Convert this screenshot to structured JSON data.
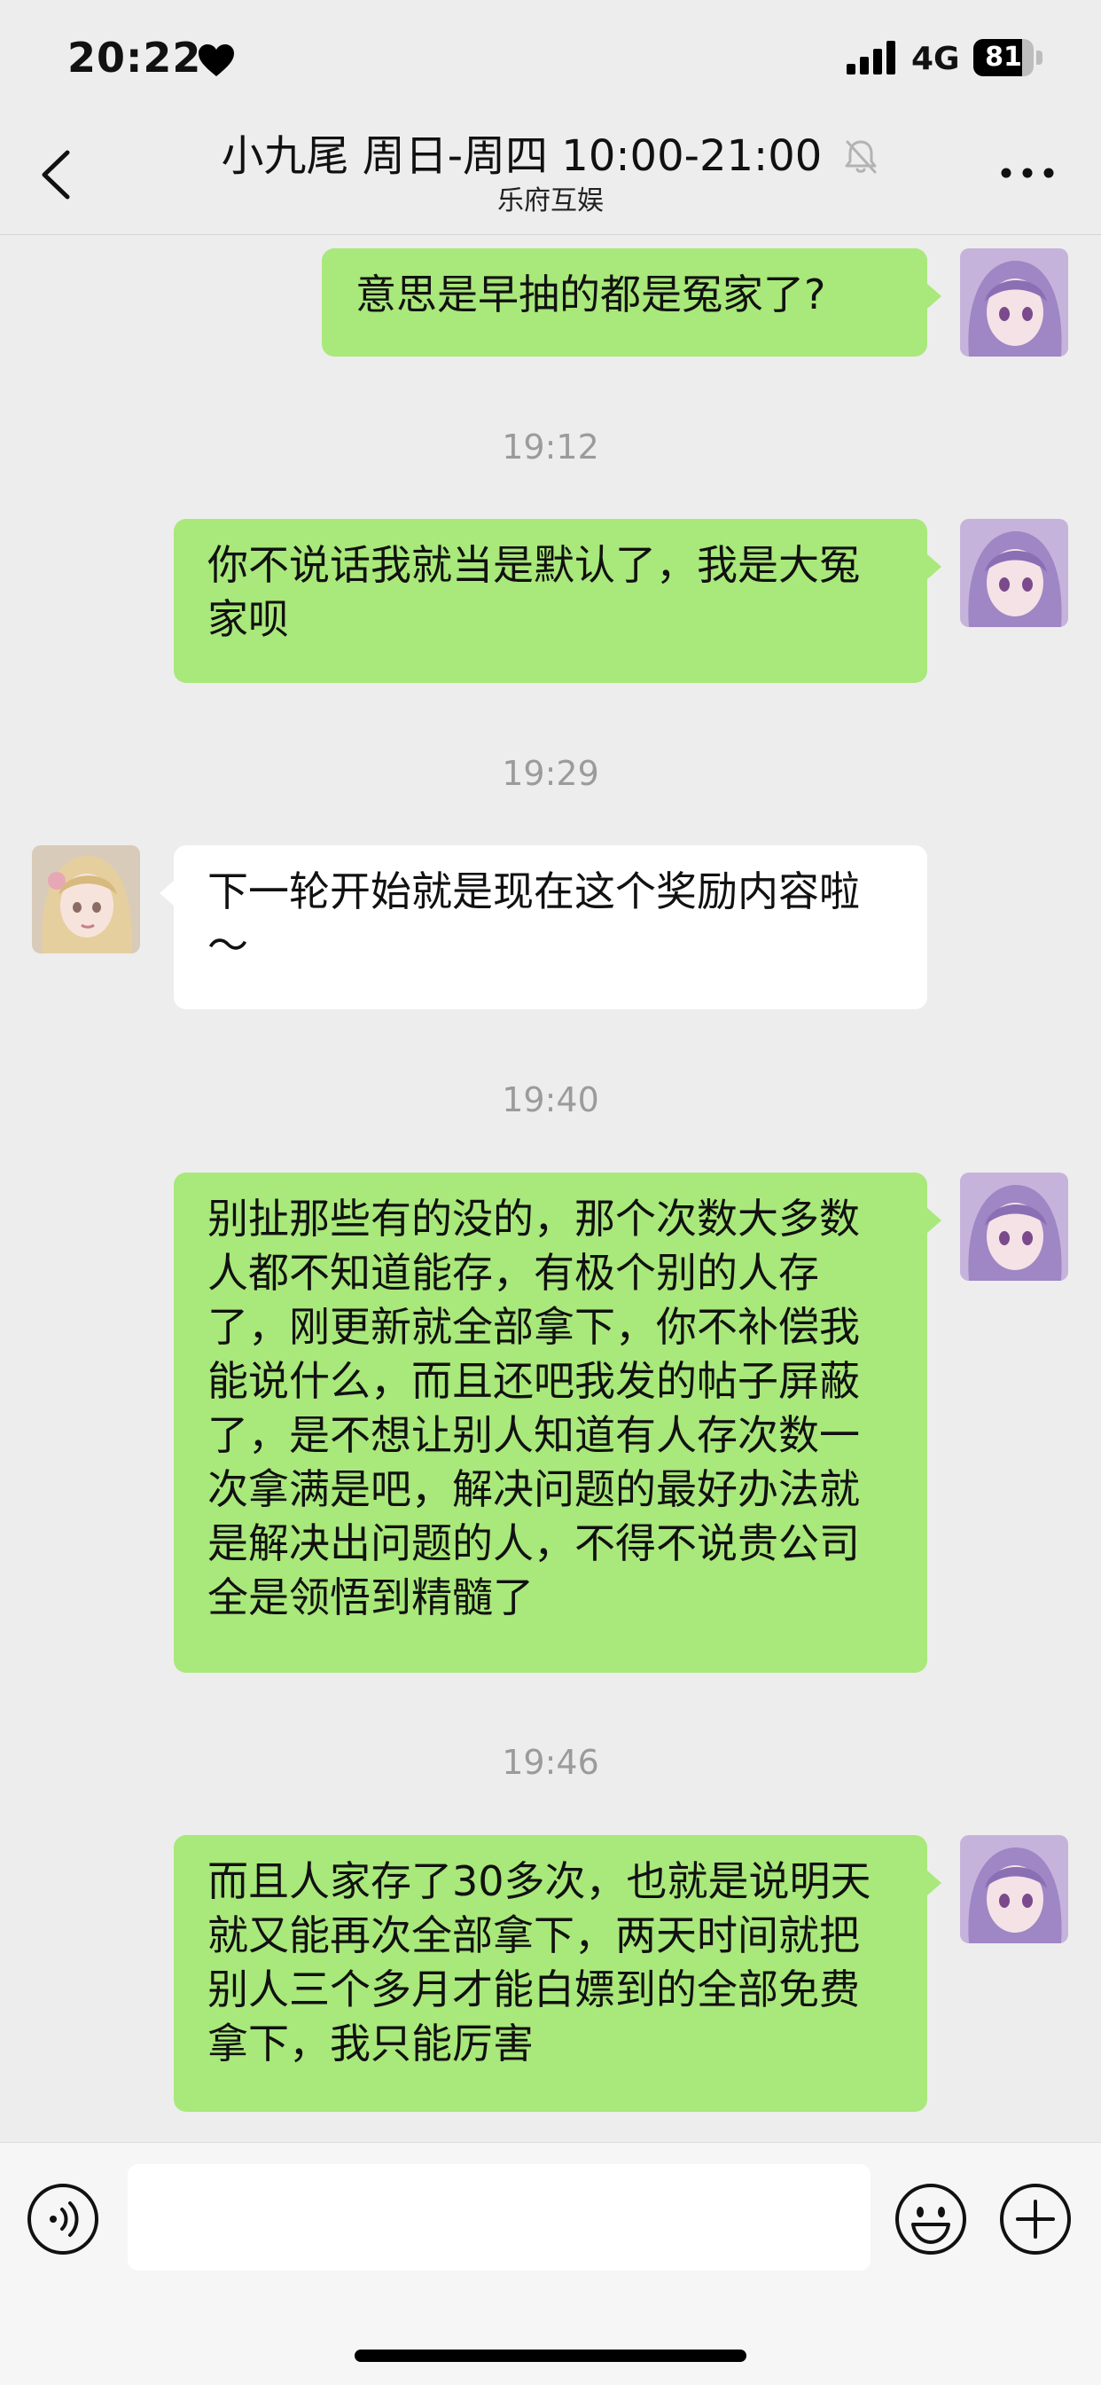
{
  "status_bar": {
    "time": "20:22",
    "network": "4G",
    "battery_level": 81,
    "battery_text": "81",
    "icons": [
      "heart-icon",
      "signal-icon",
      "battery-icon"
    ]
  },
  "header": {
    "title": "小九尾 周日-周四 10:00-21:00",
    "subtitle": "乐府互娱",
    "icons": [
      "back-icon",
      "muted-bell-icon",
      "more-icon"
    ]
  },
  "messages": [
    {
      "type": "message",
      "sender": "me",
      "text": "意思是早抽的都是冤家了?"
    },
    {
      "type": "timestamp",
      "text": "19:12"
    },
    {
      "type": "message",
      "sender": "me",
      "text": "你不说话我就当是默认了，我是大冤家呗"
    },
    {
      "type": "timestamp",
      "text": "19:29"
    },
    {
      "type": "message",
      "sender": "other",
      "text": "下一轮开始就是现在这个奖励内容啦～"
    },
    {
      "type": "timestamp",
      "text": "19:40"
    },
    {
      "type": "message",
      "sender": "me",
      "text": "别扯那些有的没的，那个次数大多数人都不知道能存，有极个别的人存了，刚更新就全部拿下，你不补偿我能说什么，而且还吧我发的帖子屏蔽了，是不想让别人知道有人存次数一次拿满是吧，解决问题的最好办法就是解决出问题的人，不得不说贵公司全是领悟到精髓了"
    },
    {
      "type": "timestamp",
      "text": "19:46"
    },
    {
      "type": "message",
      "sender": "me",
      "text": "而且人家存了30多次，也就是说明天就又能再次全部拿下，两天时间就把别人三个多月才能白嫖到的全部免费拿下，我只能厉害"
    }
  ],
  "input_bar": {
    "value": "",
    "icons": [
      "voice-icon",
      "emoji-icon",
      "plus-icon"
    ]
  },
  "colors": {
    "background": "#ededed",
    "my_bubble": "#a9e87a",
    "other_bubble": "#ffffff",
    "timestamp": "#9b9b9b"
  }
}
